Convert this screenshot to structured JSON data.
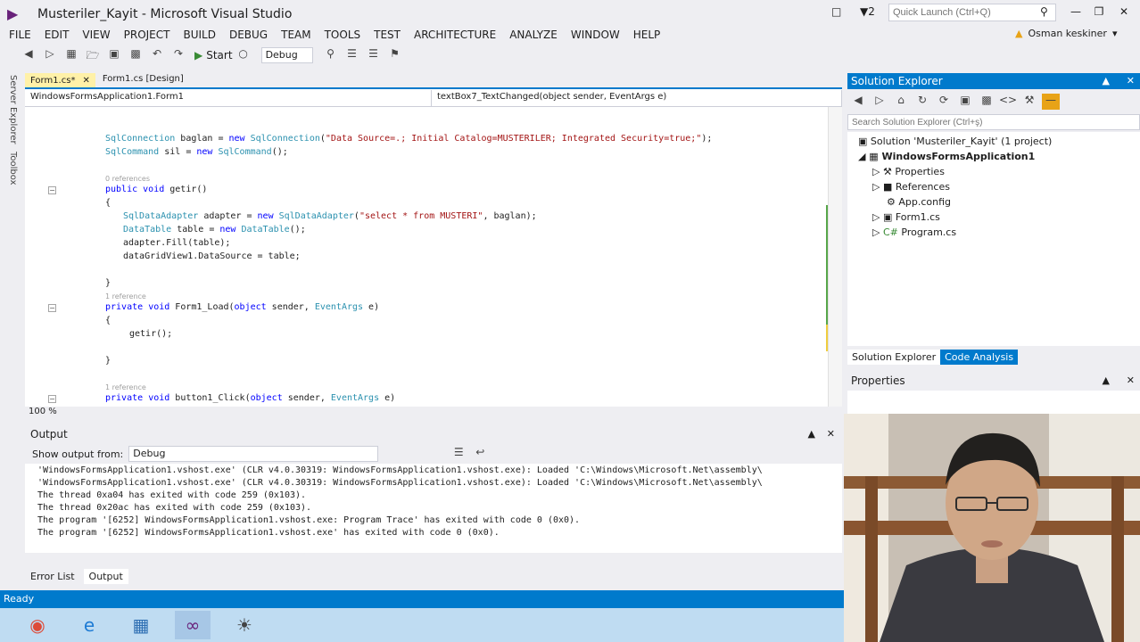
{
  "window": {
    "title": "Musteriler_Kayit - Microsoft Visual Studio",
    "notification_count": "2",
    "quick_launch_placeholder": "Quick Launch (Ctrl+Q)",
    "user_name": "Osman keskiner"
  },
  "menu": [
    "FILE",
    "EDIT",
    "VIEW",
    "PROJECT",
    "BUILD",
    "DEBUG",
    "TEAM",
    "TOOLS",
    "TEST",
    "ARCHITECTURE",
    "ANALYZE",
    "WINDOW",
    "HELP"
  ],
  "toolbar": {
    "start_label": "Start",
    "configuration": "Debug"
  },
  "side_tabs": [
    "Server Explorer",
    "Toolbox"
  ],
  "doc_tabs": [
    {
      "label": "Form1.cs*",
      "active": true
    },
    {
      "label": "Form1.cs [Design]",
      "active": false
    }
  ],
  "nav": {
    "class_scope": "WindowsFormsApplication1.Form1",
    "member_scope": "textBox7_TextChanged(object sender, EventArgs e)"
  },
  "code": {
    "line1": "SqlConnection baglan = new SqlConnection(\"Data Source=.; Initial Catalog=MUSTERILER; Integrated Security=true;\");",
    "line2": "SqlCommand sil = new SqlCommand();",
    "ref1": "0 references",
    "line3": "public void getir()",
    "line4": "{",
    "line5": "SqlDataAdapter adapter = new SqlDataAdapter(\"select * from MUSTERI\", baglan);",
    "line6": "DataTable table = new DataTable();",
    "line7": "adapter.Fill(table);",
    "line8": "dataGridView1.DataSource = table;",
    "line9": "}",
    "ref2": "1 reference",
    "line10": "private void Form1_Load(object sender, EventArgs e)",
    "line11": "{",
    "line12": "getir();",
    "line13": "}",
    "ref3": "1 reference",
    "line14": "private void button1_Click(object sender, EventArgs e)"
  },
  "zoom": "100 %",
  "output": {
    "title": "Output",
    "show_from_label": "Show output from:",
    "source": "Debug",
    "lines": [
      "'WindowsFormsApplication1.vshost.exe' (CLR v4.0.30319: WindowsFormsApplication1.vshost.exe): Loaded 'C:\\Windows\\Microsoft.Net\\assembly\\",
      "'WindowsFormsApplication1.vshost.exe' (CLR v4.0.30319: WindowsFormsApplication1.vshost.exe): Loaded 'C:\\Windows\\Microsoft.Net\\assembly\\",
      "The thread 0xa04 has exited with code 259 (0x103).",
      "The thread 0x20ac has exited with code 259 (0x103).",
      "The program '[6252] WindowsFormsApplication1.vshost.exe: Program Trace' has exited with code 0 (0x0).",
      "The program '[6252] WindowsFormsApplication1.vshost.exe' has exited with code 0 (0x0)."
    ]
  },
  "bottom_tabs": [
    "Error List",
    "Output"
  ],
  "status": "Ready",
  "solution_explorer": {
    "title": "Solution Explorer",
    "search_placeholder": "Search Solution Explorer (Ctrl+ş)",
    "tree": [
      {
        "label": "Solution 'Musteriler_Kayit' (1 project)",
        "level": 0,
        "bold": false
      },
      {
        "label": "WindowsFormsApplication1",
        "level": 1,
        "bold": true
      },
      {
        "label": "Properties",
        "level": 2,
        "bold": false
      },
      {
        "label": "References",
        "level": 2,
        "bold": false
      },
      {
        "label": "App.config",
        "level": 2,
        "bold": false
      },
      {
        "label": "Form1.cs",
        "level": 2,
        "bold": false
      },
      {
        "label": "Program.cs",
        "level": 2,
        "bold": false
      }
    ],
    "tabs": [
      "Solution Explorer",
      "Code Analysis"
    ]
  },
  "properties": {
    "title": "Properties"
  }
}
